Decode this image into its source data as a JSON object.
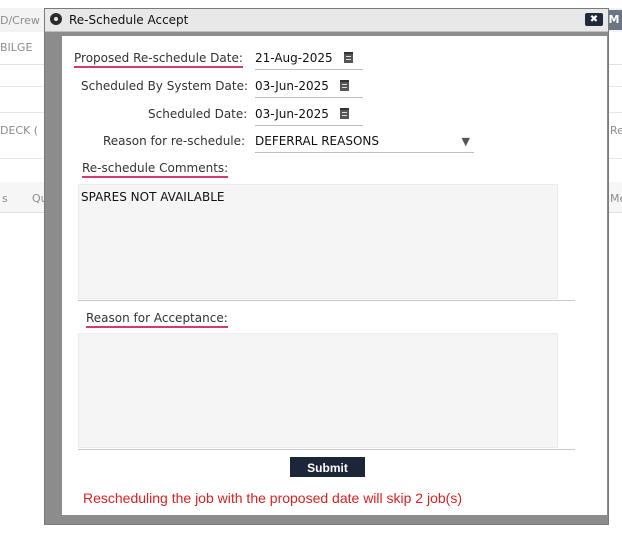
{
  "background": {
    "row1_text": "D/Crew",
    "row2_text": "BILGE",
    "row3_text": "DECK (",
    "row3_right": "Requ",
    "row4_left": "s",
    "row4_mid": "Qu",
    "row4_right": "Mes",
    "corner_badge": "M"
  },
  "dialog": {
    "title": "Re-Schedule Accept",
    "close_label": "✖",
    "icon": "circle-dot-icon",
    "proposed_label": "Proposed Re-schedule Date:",
    "proposed_value": "21-Aug-2025",
    "system_label": "Scheduled By System Date:",
    "system_value": "03-Jun-2025",
    "scheduled_label": "Scheduled Date:",
    "scheduled_value": "03-Jun-2025",
    "reason_label": "Reason for re-schedule:",
    "reason_value": "DEFERRAL REASONS",
    "comments_label": "Re-schedule Comments:",
    "comments_value": "SPARES NOT AVAILABLE",
    "acceptance_label": "Reason for Acceptance:",
    "acceptance_value": "",
    "submit_label": "Submit",
    "warning": "Rescheduling the job with the proposed date will skip 2 job(s)"
  },
  "colors": {
    "accent_underline": "#d63a6b",
    "submit_bg": "#1b2638",
    "warning_text": "#e02020"
  }
}
